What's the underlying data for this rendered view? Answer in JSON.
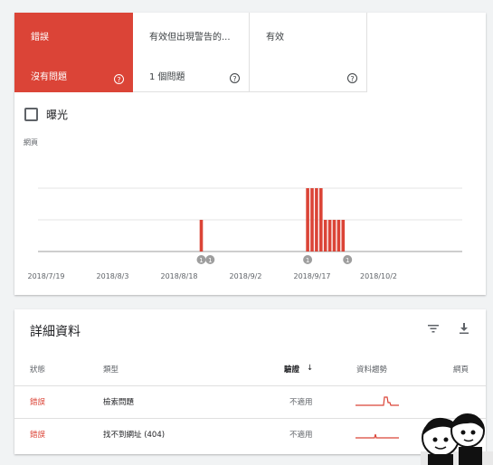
{
  "tabs": [
    {
      "title": "錯誤",
      "subtitle": "沒有問題",
      "help": "?"
    },
    {
      "title": "有效但出現警告的...",
      "subtitle": "1 個問題",
      "help": "?"
    },
    {
      "title": "有效",
      "subtitle": "",
      "help": "?"
    }
  ],
  "impressions_label": "曝光",
  "chart_data": {
    "type": "bar",
    "ylabel": "網頁",
    "x_ticks": [
      "2018/7/19",
      "2018/8/3",
      "2018/8/18",
      "2018/9/2",
      "2018/9/17",
      "2018/10/2"
    ],
    "grid": true,
    "series": [
      {
        "values": [
          {
            "date": "2018/8/23",
            "value": 1
          },
          {
            "date": "2018/9/16",
            "value": 2
          },
          {
            "date": "2018/9/17",
            "value": 2
          },
          {
            "date": "2018/9/18",
            "value": 2
          },
          {
            "date": "2018/9/19",
            "value": 2
          },
          {
            "date": "2018/9/20",
            "value": 1
          },
          {
            "date": "2018/9/21",
            "value": 1
          },
          {
            "date": "2018/9/22",
            "value": 1
          },
          {
            "date": "2018/9/23",
            "value": 1
          },
          {
            "date": "2018/9/24",
            "value": 1
          }
        ]
      }
    ],
    "annotations": [
      {
        "date": "2018/8/23",
        "label": "1"
      },
      {
        "date": "2018/8/25",
        "label": "1"
      },
      {
        "date": "2018/9/16",
        "label": "1"
      },
      {
        "date": "2018/9/25",
        "label": "1"
      }
    ],
    "colors": {
      "bar": "#db4437",
      "annotation": "#9e9e9e"
    }
  },
  "details": {
    "title": "詳細資料",
    "filter_icon": "filter-icon",
    "download_icon": "download-icon",
    "columns": {
      "status": "狀態",
      "type": "類型",
      "validation": "驗證",
      "sort_arrow": "↓",
      "trend": "資料趨勢",
      "pages": "網頁"
    },
    "rows": [
      {
        "status": "錯誤",
        "type": "檢索問題",
        "validation": "不適用"
      },
      {
        "status": "錯誤",
        "type": "找不到網址 (404)",
        "validation": "不適用"
      }
    ]
  },
  "colors": {
    "error": "#db4437",
    "accent": "#db4437"
  }
}
